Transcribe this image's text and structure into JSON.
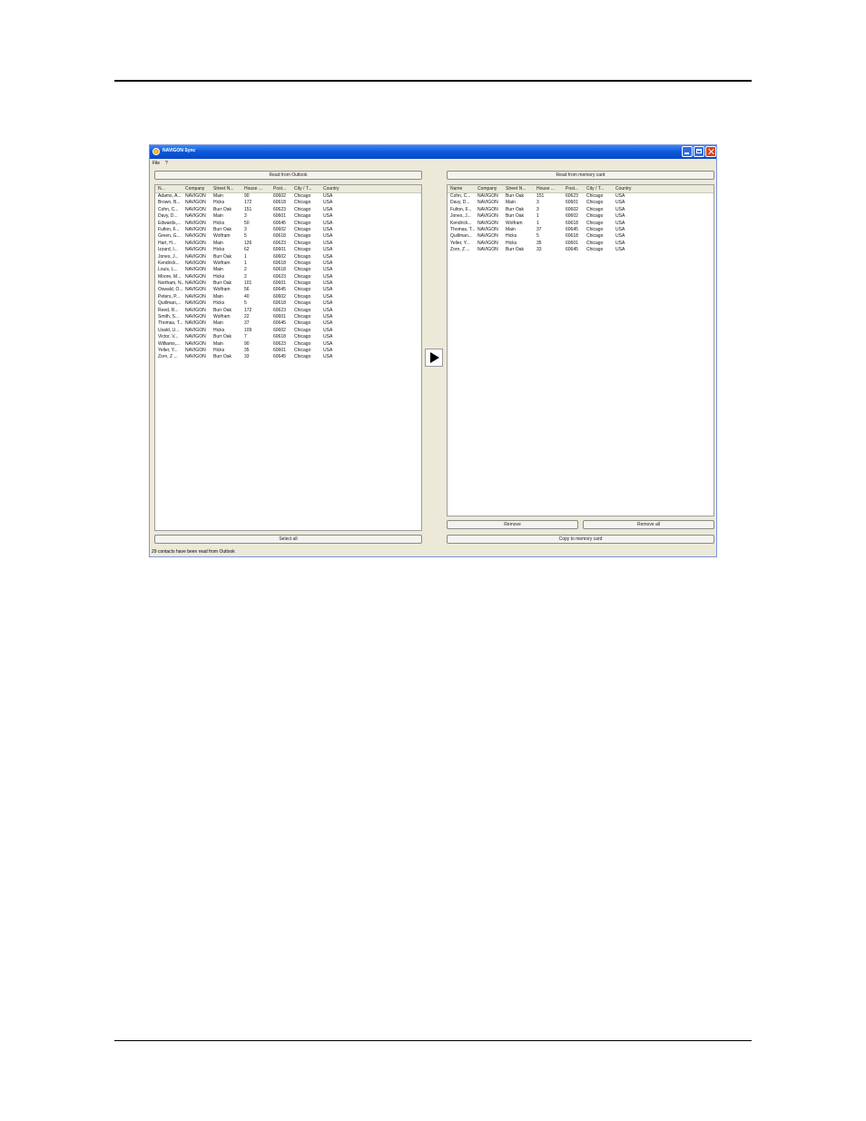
{
  "window": {
    "title": "NAVIGON Sync"
  },
  "menu": {
    "file": "File",
    "help": "?"
  },
  "left": {
    "read_button": "Read from Outlook",
    "select_all_button": "Select all",
    "columns": [
      "N...",
      "Company",
      "Street N...",
      "House ...",
      "Post...",
      "City / T...",
      "Country"
    ],
    "rows": [
      [
        "Adams, A...",
        "NAVIGON",
        "Main",
        "90",
        "60602",
        "Chicago",
        "USA"
      ],
      [
        "Brown, B...",
        "NAVIGON",
        "Hicks",
        "172",
        "60618",
        "Chicago",
        "USA"
      ],
      [
        "Cohn, C...",
        "NAVIGON",
        "Burr Oak",
        "151",
        "60623",
        "Chicago",
        "USA"
      ],
      [
        "Davy, D...",
        "NAVIGON",
        "Main",
        "3",
        "60601",
        "Chicago",
        "USA"
      ],
      [
        "Edwards,...",
        "NAVIGON",
        "Hicks",
        "50",
        "60645",
        "Chicago",
        "USA"
      ],
      [
        "Fulton, F...",
        "NAVIGON",
        "Burr Oak",
        "3",
        "60602",
        "Chicago",
        "USA"
      ],
      [
        "Green, G...",
        "NAVIGON",
        "Wolfram",
        "5",
        "60618",
        "Chicago",
        "USA"
      ],
      [
        "Hart, H...",
        "NAVIGON",
        "Main",
        "126",
        "60623",
        "Chicago",
        "USA"
      ],
      [
        "Izzard, I...",
        "NAVIGON",
        "Hicks",
        "62",
        "60601",
        "Chicago",
        "USA"
      ],
      [
        "Jones, J...",
        "NAVIGON",
        "Burr Oak",
        "1",
        "60602",
        "Chicago",
        "USA"
      ],
      [
        "Kendrick...",
        "NAVIGON",
        "Wolfram",
        "1",
        "60618",
        "Chicago",
        "USA"
      ],
      [
        "Louis, L...",
        "NAVIGON",
        "Main",
        "2",
        "60618",
        "Chicago",
        "USA"
      ],
      [
        "Moore, M...",
        "NAVIGON",
        "Hicks",
        "2",
        "60623",
        "Chicago",
        "USA"
      ],
      [
        "Northam, N...",
        "NAVIGON",
        "Burr Oak",
        "101",
        "60601",
        "Chicago",
        "USA"
      ],
      [
        "Oswald, O...",
        "NAVIGON",
        "Wolfram",
        "56",
        "60645",
        "Chicago",
        "USA"
      ],
      [
        "Peters, P...",
        "NAVIGON",
        "Main",
        "40",
        "60602",
        "Chicago",
        "USA"
      ],
      [
        "Quillman,...",
        "NAVIGON",
        "Hicks",
        "5",
        "60618",
        "Chicago",
        "USA"
      ],
      [
        "Reed, R...",
        "NAVIGON",
        "Burr Oak",
        "172",
        "60623",
        "Chicago",
        "USA"
      ],
      [
        "Smith, S...",
        "NAVIGON",
        "Wolfram",
        "22",
        "60601",
        "Chicago",
        "USA"
      ],
      [
        "Thomas, T...",
        "NAVIGON",
        "Main",
        "37",
        "60645",
        "Chicago",
        "USA"
      ],
      [
        "Usald, U...",
        "NAVIGON",
        "Hicks",
        "109",
        "60602",
        "Chicago",
        "USA"
      ],
      [
        "Victor, V...",
        "NAVIGON",
        "Burr Oak",
        "7",
        "60618",
        "Chicago",
        "USA"
      ],
      [
        "Williams,...",
        "NAVIGON",
        "Main",
        "90",
        "60623",
        "Chicago",
        "USA"
      ],
      [
        "Yeller, Y...",
        "NAVIGON",
        "Hicks",
        "35",
        "60601",
        "Chicago",
        "USA"
      ],
      [
        "Zorn, Z ...",
        "NAVIGON",
        "Burr Oak",
        "33",
        "60645",
        "Chicago",
        "USA"
      ]
    ]
  },
  "right": {
    "read_button": "Read from memory card",
    "remove_button": "Remove",
    "remove_all_button": "Remove all",
    "copy_button": "Copy to memory card",
    "columns": [
      "Name",
      "Company",
      "Street N...",
      "House ...",
      "Post...",
      "City / T...",
      "Country"
    ],
    "rows": [
      [
        "Cohn, C...",
        "NAVIGON",
        "Burr Oak",
        "151",
        "60623",
        "Chicago",
        "USA"
      ],
      [
        "Davy, D...",
        "NAVIGON",
        "Main",
        "3",
        "60601",
        "Chicago",
        "USA"
      ],
      [
        "Fulton, F...",
        "NAVIGON",
        "Burr Oak",
        "3",
        "60602",
        "Chicago",
        "USA"
      ],
      [
        "Jones, J...",
        "NAVIGON",
        "Burr Oak",
        "1",
        "60602",
        "Chicago",
        "USA"
      ],
      [
        "Kendrick...",
        "NAVIGON",
        "Wolfram",
        "1",
        "60618",
        "Chicago",
        "USA"
      ],
      [
        "Thomas, T...",
        "NAVIGON",
        "Main",
        "37",
        "60645",
        "Chicago",
        "USA"
      ],
      [
        "Quillman...",
        "NAVIGON",
        "Hicks",
        "5",
        "60618",
        "Chicago",
        "USA"
      ],
      [
        "Yeller, Y...",
        "NAVIGON",
        "Hicks",
        "35",
        "60601",
        "Chicago",
        "USA"
      ],
      [
        "Zorn, Z ...",
        "NAVIGON",
        "Burr Oak",
        "33",
        "60645",
        "Chicago",
        "USA"
      ]
    ]
  },
  "status": "29 contacts have been read from Outlook"
}
